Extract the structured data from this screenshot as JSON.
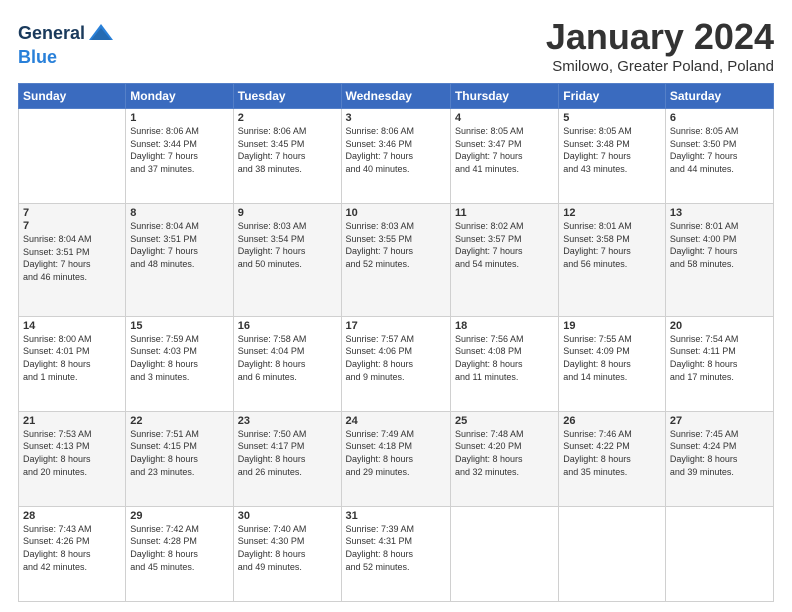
{
  "logo": {
    "line1": "General",
    "line2": "Blue"
  },
  "header": {
    "title": "January 2024",
    "subtitle": "Smilowo, Greater Poland, Poland"
  },
  "days_of_week": [
    "Sunday",
    "Monday",
    "Tuesday",
    "Wednesday",
    "Thursday",
    "Friday",
    "Saturday"
  ],
  "weeks": [
    [
      {
        "day": "",
        "info": ""
      },
      {
        "day": "1",
        "info": "Sunrise: 8:06 AM\nSunset: 3:44 PM\nDaylight: 7 hours\nand 37 minutes."
      },
      {
        "day": "2",
        "info": "Sunrise: 8:06 AM\nSunset: 3:45 PM\nDaylight: 7 hours\nand 38 minutes."
      },
      {
        "day": "3",
        "info": "Sunrise: 8:06 AM\nSunset: 3:46 PM\nDaylight: 7 hours\nand 40 minutes."
      },
      {
        "day": "4",
        "info": "Sunrise: 8:05 AM\nSunset: 3:47 PM\nDaylight: 7 hours\nand 41 minutes."
      },
      {
        "day": "5",
        "info": "Sunrise: 8:05 AM\nSunset: 3:48 PM\nDaylight: 7 hours\nand 43 minutes."
      },
      {
        "day": "6",
        "info": "Sunrise: 8:05 AM\nSunset: 3:50 PM\nDaylight: 7 hours\nand 44 minutes."
      }
    ],
    [
      {
        "day": "7",
        "info": ""
      },
      {
        "day": "8",
        "info": "Sunrise: 8:04 AM\nSunset: 3:51 PM\nDaylight: 7 hours\nand 48 minutes."
      },
      {
        "day": "9",
        "info": "Sunrise: 8:03 AM\nSunset: 3:54 PM\nDaylight: 7 hours\nand 50 minutes."
      },
      {
        "day": "10",
        "info": "Sunrise: 8:03 AM\nSunset: 3:55 PM\nDaylight: 7 hours\nand 52 minutes."
      },
      {
        "day": "11",
        "info": "Sunrise: 8:02 AM\nSunset: 3:57 PM\nDaylight: 7 hours\nand 54 minutes."
      },
      {
        "day": "12",
        "info": "Sunrise: 8:01 AM\nSunset: 3:58 PM\nDaylight: 7 hours\nand 56 minutes."
      },
      {
        "day": "13",
        "info": "Sunrise: 8:01 AM\nSunset: 4:00 PM\nDaylight: 7 hours\nand 58 minutes."
      }
    ],
    [
      {
        "day": "14",
        "info": "Sunrise: 8:00 AM\nSunset: 4:01 PM\nDaylight: 8 hours\nand 1 minute."
      },
      {
        "day": "15",
        "info": "Sunrise: 7:59 AM\nSunset: 4:03 PM\nDaylight: 8 hours\nand 3 minutes."
      },
      {
        "day": "16",
        "info": "Sunrise: 7:58 AM\nSunset: 4:04 PM\nDaylight: 8 hours\nand 6 minutes."
      },
      {
        "day": "17",
        "info": "Sunrise: 7:57 AM\nSunset: 4:06 PM\nDaylight: 8 hours\nand 9 minutes."
      },
      {
        "day": "18",
        "info": "Sunrise: 7:56 AM\nSunset: 4:08 PM\nDaylight: 8 hours\nand 11 minutes."
      },
      {
        "day": "19",
        "info": "Sunrise: 7:55 AM\nSunset: 4:09 PM\nDaylight: 8 hours\nand 14 minutes."
      },
      {
        "day": "20",
        "info": "Sunrise: 7:54 AM\nSunset: 4:11 PM\nDaylight: 8 hours\nand 17 minutes."
      }
    ],
    [
      {
        "day": "21",
        "info": "Sunrise: 7:53 AM\nSunset: 4:13 PM\nDaylight: 8 hours\nand 20 minutes."
      },
      {
        "day": "22",
        "info": "Sunrise: 7:51 AM\nSunset: 4:15 PM\nDaylight: 8 hours\nand 23 minutes."
      },
      {
        "day": "23",
        "info": "Sunrise: 7:50 AM\nSunset: 4:17 PM\nDaylight: 8 hours\nand 26 minutes."
      },
      {
        "day": "24",
        "info": "Sunrise: 7:49 AM\nSunset: 4:18 PM\nDaylight: 8 hours\nand 29 minutes."
      },
      {
        "day": "25",
        "info": "Sunrise: 7:48 AM\nSunset: 4:20 PM\nDaylight: 8 hours\nand 32 minutes."
      },
      {
        "day": "26",
        "info": "Sunrise: 7:46 AM\nSunset: 4:22 PM\nDaylight: 8 hours\nand 35 minutes."
      },
      {
        "day": "27",
        "info": "Sunrise: 7:45 AM\nSunset: 4:24 PM\nDaylight: 8 hours\nand 39 minutes."
      }
    ],
    [
      {
        "day": "28",
        "info": "Sunrise: 7:43 AM\nSunset: 4:26 PM\nDaylight: 8 hours\nand 42 minutes."
      },
      {
        "day": "29",
        "info": "Sunrise: 7:42 AM\nSunset: 4:28 PM\nDaylight: 8 hours\nand 45 minutes."
      },
      {
        "day": "30",
        "info": "Sunrise: 7:40 AM\nSunset: 4:30 PM\nDaylight: 8 hours\nand 49 minutes."
      },
      {
        "day": "31",
        "info": "Sunrise: 7:39 AM\nSunset: 4:31 PM\nDaylight: 8 hours\nand 52 minutes."
      },
      {
        "day": "",
        "info": ""
      },
      {
        "day": "",
        "info": ""
      },
      {
        "day": "",
        "info": ""
      }
    ]
  ]
}
